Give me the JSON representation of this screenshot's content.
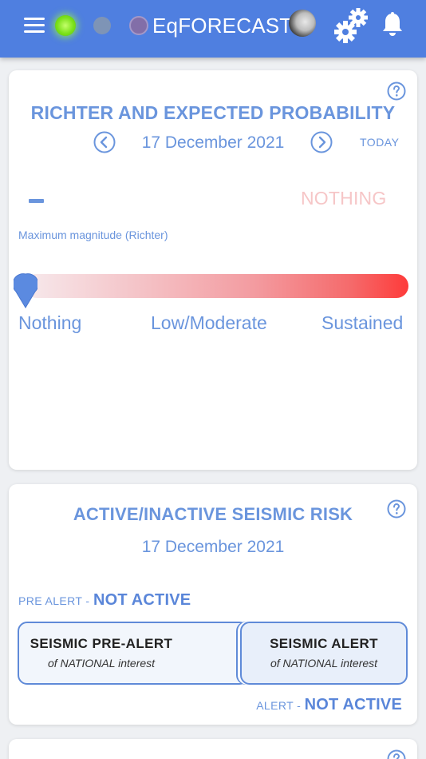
{
  "header": {
    "title": "EqFORECAST",
    "icons": [
      "menu-icon",
      "status-dot-green",
      "status-dot-gray",
      "status-dot-purple",
      "moon-phase-icon",
      "gears-icon",
      "bell-icon"
    ],
    "colors": {
      "bar": "#4f7fe0",
      "accent": "#6a95dd"
    }
  },
  "richter_card": {
    "title": "RICHTER AND EXPECTED PROBABILITY",
    "date": "17 December 2021",
    "today_label": "TODAY",
    "magnitude_value": "–",
    "probability_status": "NOTHING",
    "magnitude_label": "Maximum magnitude (Richter)",
    "scale_labels": [
      "Nothing",
      "Low/Moderate",
      "Sustained"
    ],
    "scale_level": 0
  },
  "risk_card": {
    "title": "ACTIVE/INACTIVE SEISMIC RISK",
    "date": "17 December 2021",
    "pre_alert_prefix": "PRE ALERT -",
    "pre_alert_status": "NOT ACTIVE",
    "alert_prefix": "ALERT -",
    "alert_status": "NOT ACTIVE",
    "pre_alert_button": {
      "title": "SEISMIC PRE-ALERT",
      "subtitle": "of NATIONAL interest"
    },
    "alert_button": {
      "title": "SEISMIC ALERT",
      "subtitle": "of NATIONAL interest"
    }
  }
}
